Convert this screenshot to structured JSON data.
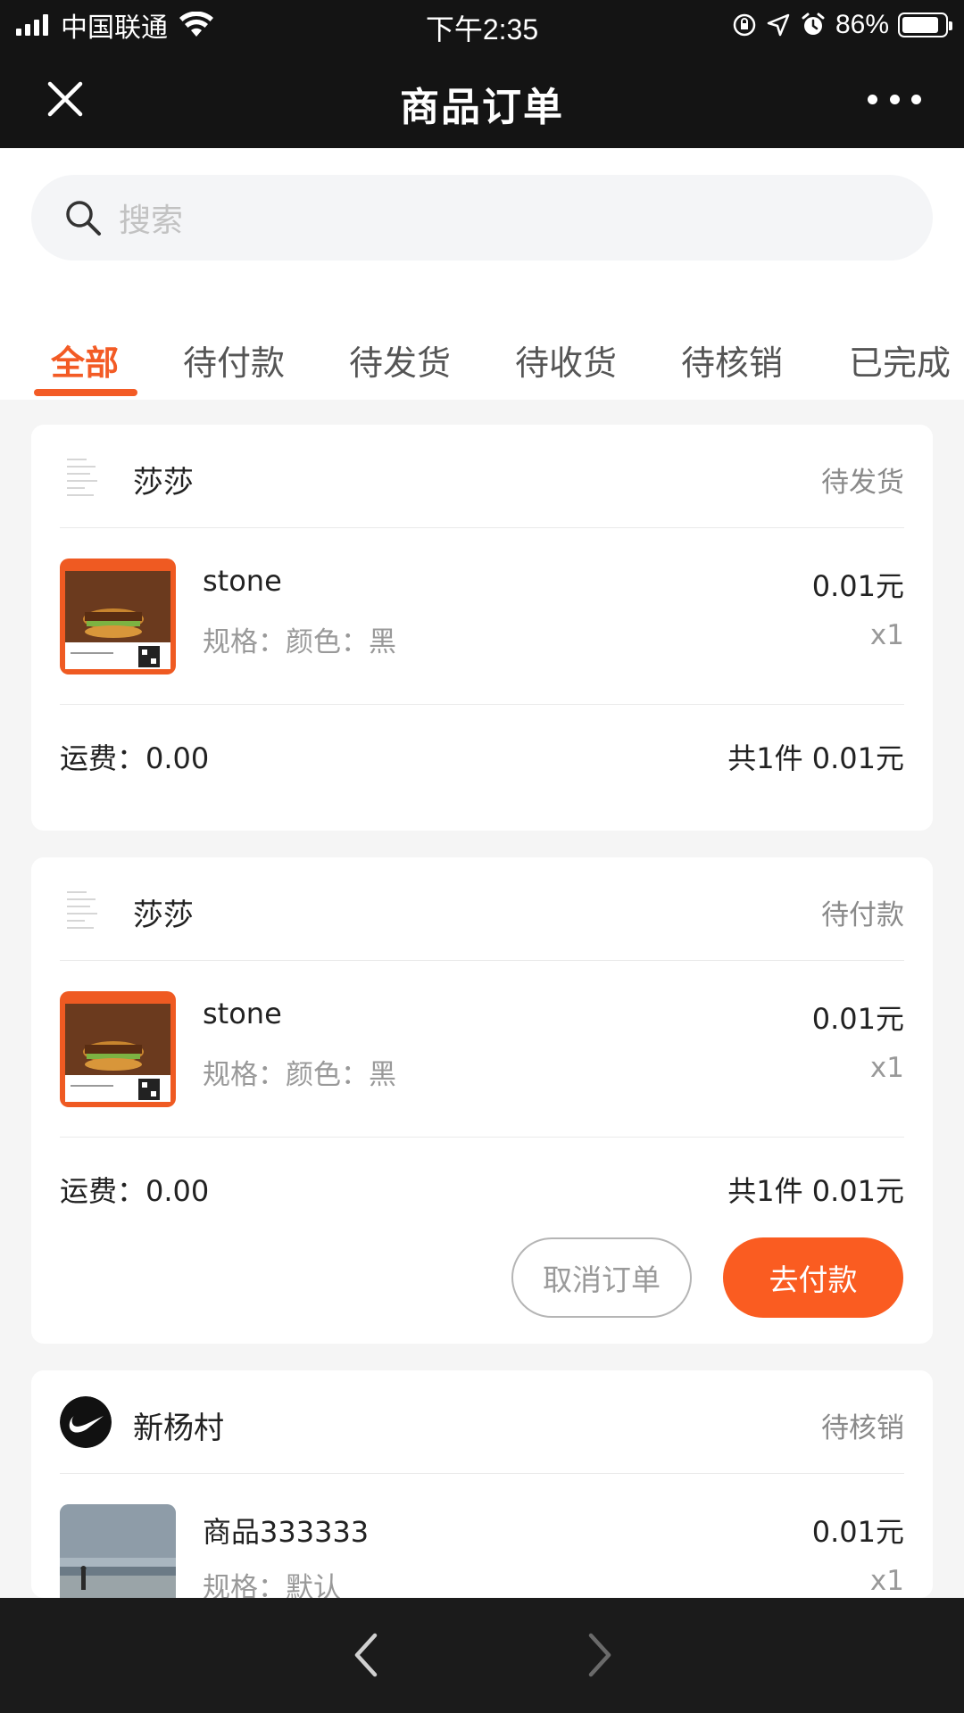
{
  "status_bar": {
    "carrier": "中国联通",
    "time": "下午2:35",
    "battery": "86%",
    "battery_level": 0.86,
    "icons": [
      "signal-icon",
      "wifi-icon",
      "orientation-lock-icon",
      "location-icon",
      "alarm-icon",
      "battery-icon"
    ]
  },
  "header": {
    "title": "商品订单",
    "close_icon": "close-icon",
    "more_icon": "more-icon"
  },
  "search": {
    "placeholder": "搜索",
    "icon": "search-icon"
  },
  "tabs": [
    {
      "label": "全部",
      "active": true
    },
    {
      "label": "待付款",
      "active": false
    },
    {
      "label": "待发货",
      "active": false
    },
    {
      "label": "待收货",
      "active": false
    },
    {
      "label": "待核销",
      "active": false
    },
    {
      "label": "已完成",
      "active": false
    }
  ],
  "orders": [
    {
      "shop": "莎莎",
      "status": "待发货",
      "item": {
        "name": "stone",
        "spec": "规格：颜色：黑",
        "price": "0.01元",
        "qty": "x1"
      },
      "shipping": "运费：0.00",
      "total": "共1件  0.01元"
    },
    {
      "shop": "莎莎",
      "status": "待付款",
      "item": {
        "name": "stone",
        "spec": "规格：颜色：黑",
        "price": "0.01元",
        "qty": "x1"
      },
      "shipping": "运费：0.00",
      "total": "共1件  0.01元",
      "buttons": {
        "cancel": "取消订单",
        "pay": "去付款"
      }
    },
    {
      "shop": "新杨村",
      "status": "待核销",
      "item": {
        "name": "商品333333",
        "spec": "规格：默认",
        "price": "0.01元",
        "qty": "x1"
      }
    }
  ],
  "colors": {
    "accent": "#f35b25",
    "pay_button": "#fa5c21",
    "header_bg": "#141414",
    "page_bg": "#f5f5f5"
  },
  "bottom_nav": {
    "back_icon": "chevron-left-icon",
    "forward_icon": "chevron-right-icon"
  }
}
